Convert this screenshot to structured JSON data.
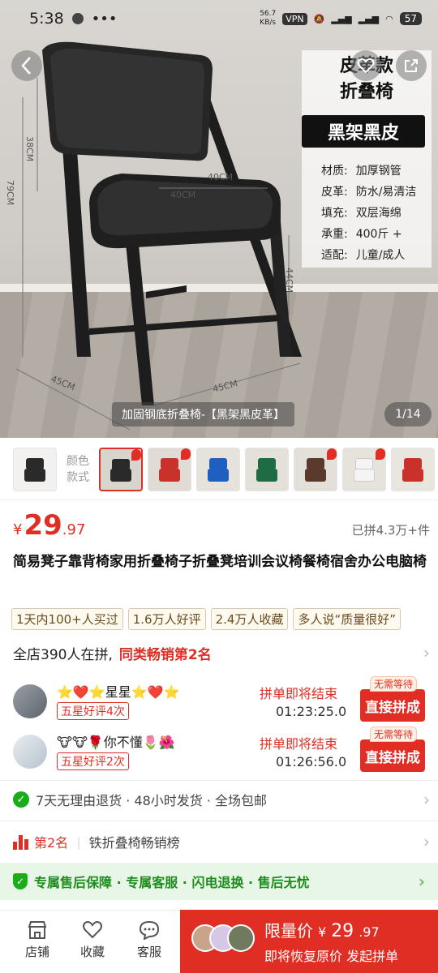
{
  "status": {
    "time": "5:38",
    "speed_value": "56.7",
    "speed_unit": "KB/s",
    "vpn": "VPN",
    "battery": "57"
  },
  "hero": {
    "spec_title_line1": "皮革款",
    "spec_title_line2": "折叠椅",
    "spec_badge": "黑架黑皮",
    "specs": [
      {
        "k": "材质:",
        "v": "加厚钢管"
      },
      {
        "k": "皮革:",
        "v": "防水/易清洁"
      },
      {
        "k": "填充:",
        "v": "双层海绵"
      },
      {
        "k": "承重:",
        "v": "400斤 +"
      },
      {
        "k": "适配:",
        "v": "儿童/成人"
      }
    ],
    "dims": {
      "back": "38CM",
      "total": "79CM",
      "seat_w1": "40CM",
      "seat_w2": "40CM",
      "leg": "44CM",
      "base1": "45CM",
      "base2": "45CM"
    },
    "caption": "加固钢底折叠椅-【黑架黑皮革】",
    "counter": "1/14"
  },
  "thumbs": {
    "label_line1": "颜色",
    "label_line2": "款式",
    "items": [
      {
        "seat": "#2a2a2a",
        "back": "#2a2a2a",
        "bg": "#e9e7e3"
      },
      {
        "seat": "#2a2a2a",
        "back": "#2a2a2a",
        "bg": "#d8d4ce"
      },
      {
        "seat": "#c8322b",
        "back": "#c8322b",
        "bg": "#e0dbd4"
      },
      {
        "seat": "#1f5fbf",
        "back": "#1f5fbf",
        "bg": "#e6e2dc"
      },
      {
        "seat": "#1e6b44",
        "back": "#1e6b44",
        "bg": "#e4e0da"
      },
      {
        "seat": "#5a3a2a",
        "back": "#5a3a2a",
        "bg": "#e3dfd9"
      },
      {
        "seat": "#f4f4f4",
        "back": "#f4f4f4",
        "bg": "#e6e2dc"
      },
      {
        "seat": "#c8322b",
        "back": "#c8322b",
        "bg": "#e9e5df"
      }
    ]
  },
  "price": {
    "currency": "¥",
    "integer": "29",
    "decimal": ".97",
    "sold": "已拼4.3万+件"
  },
  "title": "简易凳子靠背椅家用折叠椅子折叠凳培训会议椅餐椅宿舍办公电脑椅",
  "tags": [
    "1天内100+人买过",
    "1.6万人好评",
    "2.4万人收藏",
    "多人说“质量很好”"
  ],
  "store": {
    "text": "全店390人在拼,",
    "highlight": "同类畅销第2名"
  },
  "groups": [
    {
      "name": "⭐❤️⭐星星⭐❤️⭐",
      "badge": "五星好评4次",
      "ending": "拼单即将结束",
      "timer": "01:23:25.0",
      "join": "直接拼成",
      "nowait": "无需等待"
    },
    {
      "name": "🐮🐮🌹你不懂🌷🌺",
      "badge": "五星好评2次",
      "ending": "拼单即将结束",
      "timer": "01:26:56.0",
      "join": "直接拼成",
      "nowait": "无需等待"
    }
  ],
  "service": {
    "text": "7天无理由退货 · 48小时发货 · 全场包邮"
  },
  "rank": {
    "rank": "第2名",
    "list": "铁折叠椅畅销榜"
  },
  "after_sale": {
    "text": "专属售后保障 · 专属客服 · 闪电退换 · 售后无忧"
  },
  "bottom": {
    "shop": "店铺",
    "fav": "收藏",
    "service": "客服",
    "limit_label": "限量价",
    "limit_currency": "¥",
    "limit_int": "29",
    "limit_dec": ".97",
    "action": "即将恢复原价 发起拼单"
  },
  "colors": {
    "accent": "#e02e24",
    "green": "#1aad19"
  }
}
